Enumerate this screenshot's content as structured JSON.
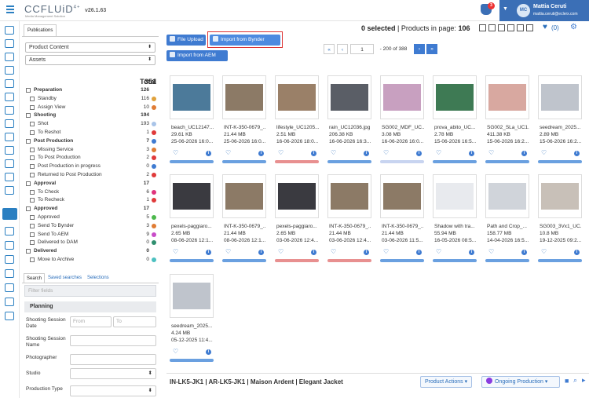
{
  "app": {
    "logo": "CCFLUiD",
    "logo_sup": "4+",
    "logo_sub": "Media Management Solution",
    "version": "v26.1.63"
  },
  "user": {
    "name": "Mattia Ceruti",
    "email": "mattia.ceruti@eclerx.com",
    "initials": "MC",
    "notifications": "3"
  },
  "left": {
    "tab": "Publications",
    "product_select": "Product Content",
    "asset_select": "Assets",
    "total_label": "Total",
    "total_count": "351",
    "rows": [
      {
        "label": "Preparation",
        "count": "126",
        "bold": true,
        "indent": 0,
        "color": ""
      },
      {
        "label": "Standby",
        "count": "116",
        "bold": false,
        "indent": 1,
        "color": "#e0a23c"
      },
      {
        "label": "Assign View",
        "count": "10",
        "bold": false,
        "indent": 1,
        "color": "#e07c34"
      },
      {
        "label": "Shooting",
        "count": "194",
        "bold": true,
        "indent": 0,
        "color": ""
      },
      {
        "label": "Shot",
        "count": "193",
        "bold": false,
        "indent": 1,
        "color": "#a9c4e8"
      },
      {
        "label": "To Reshot",
        "count": "1",
        "bold": false,
        "indent": 1,
        "color": "#e03a3a"
      },
      {
        "label": "Post Production",
        "count": "7",
        "bold": true,
        "indent": 0,
        "color": "#3f7bd1"
      },
      {
        "label": "Missing Service",
        "count": "3",
        "bold": false,
        "indent": 1,
        "color": "#e07c34"
      },
      {
        "label": "To Post Production",
        "count": "2",
        "bold": false,
        "indent": 1,
        "color": "#e03a3a"
      },
      {
        "label": "Post Production in progress",
        "count": "0",
        "bold": false,
        "indent": 1,
        "color": "#3f7bd1"
      },
      {
        "label": "Returned to Post Production",
        "count": "2",
        "bold": false,
        "indent": 1,
        "color": "#e03a3a"
      },
      {
        "label": "Approval",
        "count": "17",
        "bold": true,
        "indent": 0,
        "color": ""
      },
      {
        "label": "To Check",
        "count": "6",
        "bold": false,
        "indent": 1,
        "color": "#e0347c"
      },
      {
        "label": "To Recheck",
        "count": "1",
        "bold": false,
        "indent": 1,
        "color": "#e03a3a"
      },
      {
        "label": "Approved",
        "count": "17",
        "bold": true,
        "indent": 0,
        "color": ""
      },
      {
        "label": "Approved",
        "count": "5",
        "bold": false,
        "indent": 1,
        "color": "#4cb84c"
      },
      {
        "label": "Send To Bynder",
        "count": "3",
        "bold": false,
        "indent": 1,
        "color": "#e07c34"
      },
      {
        "label": "Send To AEM",
        "count": "9",
        "bold": false,
        "indent": 1,
        "color": "#c84cc8"
      },
      {
        "label": "Delivered to DAM",
        "count": "0",
        "bold": false,
        "indent": 1,
        "color": "#2f8f6f"
      },
      {
        "label": "Delivered",
        "count": "0",
        "bold": true,
        "indent": 0,
        "color": ""
      },
      {
        "label": "Move to Archive",
        "count": "0",
        "bold": false,
        "indent": 1,
        "color": "#4cc0c0"
      }
    ],
    "search_tabs": [
      "Search",
      "Saved searches",
      "Selections"
    ],
    "filter_placeholder": "Filter fields",
    "section": "Planning",
    "fields": {
      "shooting_date": "Shooting Session Date",
      "from": "From",
      "to": "To",
      "session_name": "Shooting Session Name",
      "photographer": "Photographer",
      "studio": "Studio",
      "production_type": "Production Type"
    }
  },
  "toolbar": {
    "file_upload": "File Upload",
    "bynder": "Import from Bynder",
    "aem": "Import from AEM",
    "selected": "0 selected",
    "per_page_label": "| Products in page:",
    "per_page": "106",
    "fav_count": "(0)"
  },
  "pager": {
    "first": "«",
    "prev": "‹",
    "page": "1",
    "range": "- 200 of 388",
    "next": "›",
    "last": "»"
  },
  "cards": [
    {
      "name": "beach_UC12147...",
      "size": "29.61 KB",
      "date": "25-06-2026 16:0...",
      "bar": "#6aa0e0",
      "img": "#4c7a9a"
    },
    {
      "name": "INT-K-350-0679_...",
      "size": "21.44 MB",
      "date": "25-06-2026 16:0...",
      "bar": "#6aa0e0",
      "img": "#8c7a66"
    },
    {
      "name": "lifestyle_UC1205...",
      "size": "2.51 MB",
      "date": "16-06-2026 18:0...",
      "bar": "#e89090",
      "img": "#9a8068"
    },
    {
      "name": "rain_UC12036.jpg",
      "size": "206.38 KB",
      "date": "16-06-2026 16:3...",
      "bar": "#6aa0e0",
      "img": "#5a5e66"
    },
    {
      "name": "SG002_MDF_UC...",
      "size": "3.08 MB",
      "date": "16-06-2026 16:0...",
      "bar": "#c8d4f0",
      "img": "#c8a0c0"
    },
    {
      "name": "prova_abito_UC...",
      "size": "2.78 MB",
      "date": "15-06-2026 16:5...",
      "bar": "#6aa0e0",
      "img": "#3e7a54"
    },
    {
      "name": "SG002_SLa_UC1...",
      "size": "411.38 KB",
      "date": "15-06-2026 16:2...",
      "bar": "#6aa0e0",
      "img": "#d8a8a0"
    },
    {
      "name": "seedream_2025...",
      "size": "2.89 MB",
      "date": "15-06-2026 16:2...",
      "bar": "#6aa0e0",
      "img": "#bfc4cc"
    },
    {
      "name": "pexels-paggiaro...",
      "size": "2.65 MB",
      "date": "08-06-2026 12:1...",
      "bar": "#6aa0e0",
      "img": "#3a3a40"
    },
    {
      "name": "INT-K-350-0679_...",
      "size": "21.44 MB",
      "date": "08-06-2026 12:1...",
      "bar": "#6aa0e0",
      "img": "#8c7a66"
    },
    {
      "name": "pexels-paggiaro...",
      "size": "2.65 MB",
      "date": "03-06-2026 12:4...",
      "bar": "#e89090",
      "img": "#3a3a40"
    },
    {
      "name": "INT-K-350-0679_...",
      "size": "21.44 MB",
      "date": "03-06-2026 12:4...",
      "bar": "#e89090",
      "img": "#8c7a66"
    },
    {
      "name": "INT-K-350-0679_...",
      "size": "21.44 MB",
      "date": "03-06-2026 11:5...",
      "bar": "#6aa0e0",
      "img": "#8c7a66"
    },
    {
      "name": "Shadow with tra...",
      "size": "55.94 MB",
      "date": "16-05-2026 08:5...",
      "bar": "#6aa0e0",
      "img": "#e8eaee"
    },
    {
      "name": "Path and Crop_...",
      "size": "158.77 MB",
      "date": "14-04-2026 16:5...",
      "bar": "#6aa0e0",
      "img": "#d0d4da"
    },
    {
      "name": "SG003_3Vx1_UC...",
      "size": "10.8 MB",
      "date": "19-12-2025 09:2...",
      "bar": "#6aa0e0",
      "img": "#c8c0b8"
    },
    {
      "name": "seedream_2025...",
      "size": "4.24 MB",
      "date": "05-12-2025 11:4...",
      "bar": "#6aa0e0",
      "img": "#bfc4cc"
    }
  ],
  "bottom": {
    "title": "IN-LK5-JK1 | AR-LK5-JK1 | Maison Ardent | Elegant Jacket",
    "actions": "Product Actions",
    "status": "Ongoing Production"
  }
}
